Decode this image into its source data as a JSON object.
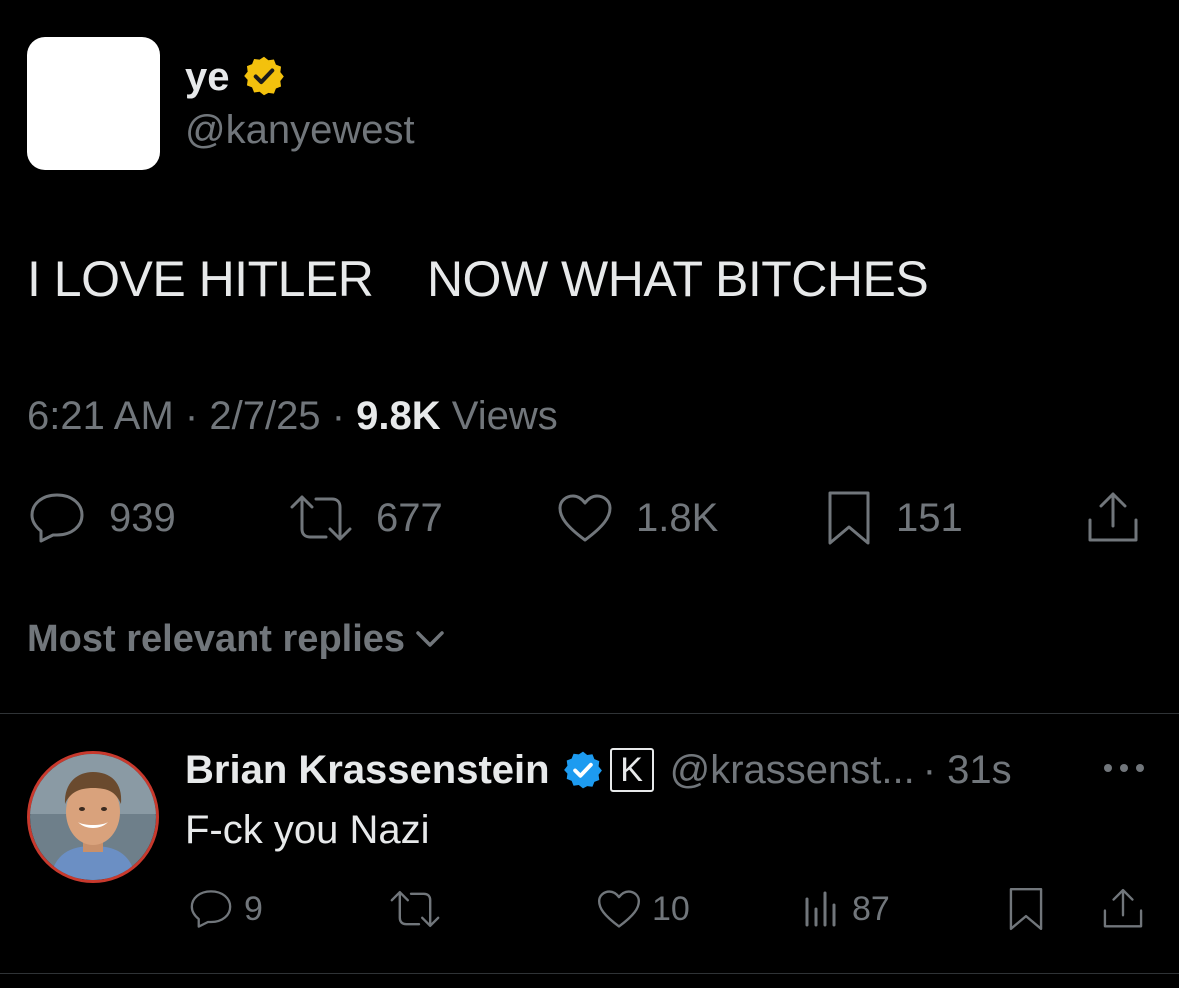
{
  "tweet": {
    "author_name": "ye",
    "author_handle": "@kanyewest",
    "text": "I LOVE HITLER    NOW WHAT BITCHES",
    "time": "6:21 AM",
    "date": "2/7/25",
    "views_count": "9.8K",
    "views_label": "Views",
    "separator": "·",
    "verified_color": "#f3c10d",
    "actions": {
      "replies": "939",
      "retweets": "677",
      "likes": "1.8K",
      "bookmarks": "151"
    }
  },
  "replies_section": {
    "label": "Most relevant replies"
  },
  "reply": {
    "author_name": "Brian Krassenstein",
    "author_handle": "@krassenst...",
    "time": "· 31s",
    "affiliate_letter": "K",
    "text": "F-ck you Nazi",
    "verified_color": "#1d9bf0",
    "actions": {
      "replies": "9",
      "likes": "10",
      "views": "87"
    }
  },
  "colors": {
    "background": "#000000",
    "text_primary": "#e7e9ea",
    "text_muted": "#71767b",
    "divider": "#2f3336"
  }
}
